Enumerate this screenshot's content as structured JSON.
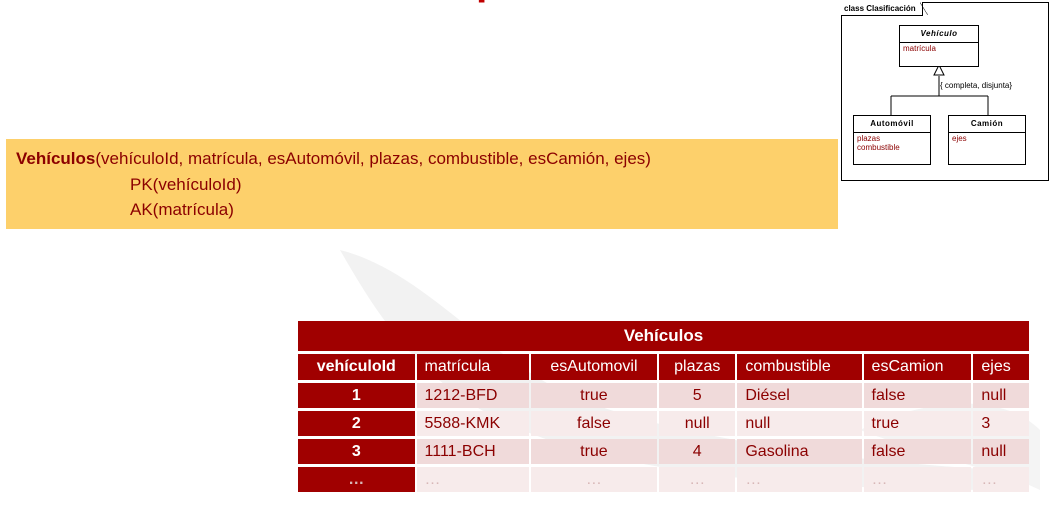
{
  "uml": {
    "frame_label": "class Clasificación",
    "superclass": {
      "name": "Vehículo",
      "attributes": [
        "matrícula"
      ]
    },
    "constraint": "{ completa, disjunta}",
    "subclasses": [
      {
        "name": "Automóvil",
        "attributes": [
          "plazas",
          "combustible"
        ]
      },
      {
        "name": "Camión",
        "attributes": [
          "ejes"
        ]
      }
    ]
  },
  "relation": {
    "name": "Vehículos",
    "attributes": "(vehículoId, matrícula, esAutomóvil, plazas, combustible, esCamión, ejes)",
    "pk": "PK(vehículoId)",
    "ak": "AK(matrícula)"
  },
  "table": {
    "caption": "Vehículos",
    "columns": [
      "vehículoId",
      "matrícula",
      "esAutomovil",
      "plazas",
      "combustible",
      "esCamion",
      "ejes"
    ],
    "rows": [
      [
        "1",
        "1212-BFD",
        "true",
        "5",
        "Diésel",
        "false",
        "null"
      ],
      [
        "2",
        "5588-KMK",
        "false",
        "null",
        "null",
        "true",
        "3"
      ],
      [
        "3",
        "1111-BCH",
        "true",
        "4",
        "Gasolina",
        "false",
        "null"
      ],
      [
        "…",
        "…",
        "…",
        "…",
        "…",
        "…",
        "…"
      ]
    ]
  }
}
